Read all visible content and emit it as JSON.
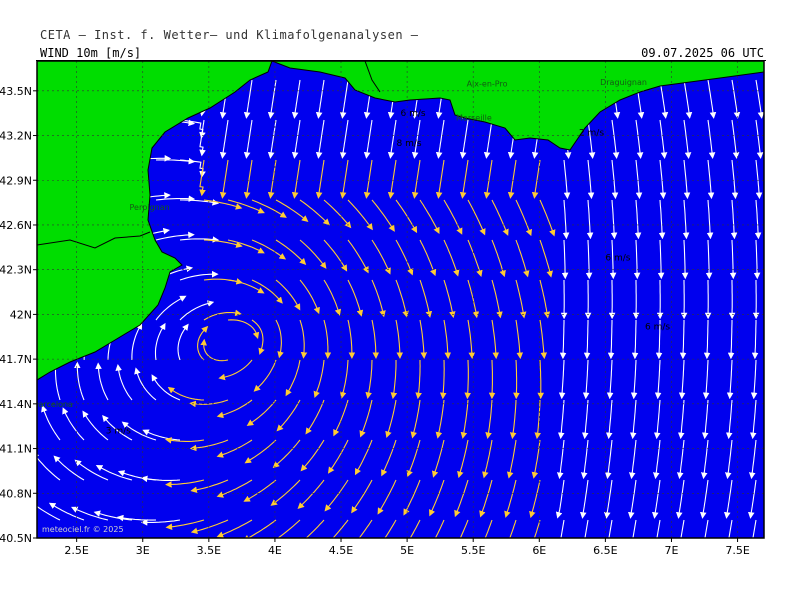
{
  "header": {
    "title": "CETA — Inst. f. Wetter— und Klimafolgenanalysen —",
    "variable": "WIND  10m  [m/s]",
    "datetime": "09.07.2025 06 UTC"
  },
  "colors": {
    "sea": "#0000ee",
    "land": "#00dd00",
    "stream_white": "#ffffff",
    "stream_yellow": "#ffcc33",
    "coastline": "#000000"
  },
  "chart_data": {
    "type": "streamline-map",
    "x_ticks": [
      "2.5E",
      "3E",
      "3.5E",
      "4E",
      "4.5E",
      "5E",
      "5.5E",
      "6E",
      "6.5E",
      "7E",
      "7.5E"
    ],
    "x_values": [
      2.5,
      3.0,
      3.5,
      4.0,
      4.5,
      5.0,
      5.5,
      6.0,
      6.5,
      7.0,
      7.5
    ],
    "y_ticks": [
      "43.5N",
      "43.2N",
      "42.9N",
      "42.6N",
      "42.3N",
      "42N",
      "41.7N",
      "41.4N",
      "41.1N",
      "40.8N",
      "40.5N"
    ],
    "y_values": [
      43.5,
      43.2,
      42.9,
      42.6,
      42.3,
      42.0,
      41.7,
      41.4,
      41.1,
      40.8,
      40.5
    ],
    "xlim": [
      2.2,
      7.7
    ],
    "ylim": [
      40.5,
      43.7
    ],
    "cities": [
      {
        "name": "Perpignan",
        "lon": 2.9,
        "lat": 42.7
      },
      {
        "name": "Barcelona",
        "lon": 2.17,
        "lat": 41.38
      },
      {
        "name": "Marseille",
        "lon": 5.37,
        "lat": 43.3
      },
      {
        "name": "Aix-en-Pro",
        "lon": 5.45,
        "lat": 43.53
      },
      {
        "name": "Draguignan",
        "lon": 6.46,
        "lat": 43.54
      }
    ],
    "speed_labels": [
      {
        "text": "6 m/s",
        "lon": 4.95,
        "lat": 43.33
      },
      {
        "text": "8 m/s",
        "lon": 4.92,
        "lat": 43.13
      },
      {
        "text": "2 m/s",
        "lon": 6.3,
        "lat": 43.2
      },
      {
        "text": "6 m/s",
        "lon": 6.5,
        "lat": 42.36
      },
      {
        "text": "6 m/s",
        "lon": 6.8,
        "lat": 41.9
      },
      {
        "text": "3 m/s",
        "lon": 2.72,
        "lat": 41.2
      }
    ],
    "copyright": "meteociel.fr  © 2025"
  }
}
